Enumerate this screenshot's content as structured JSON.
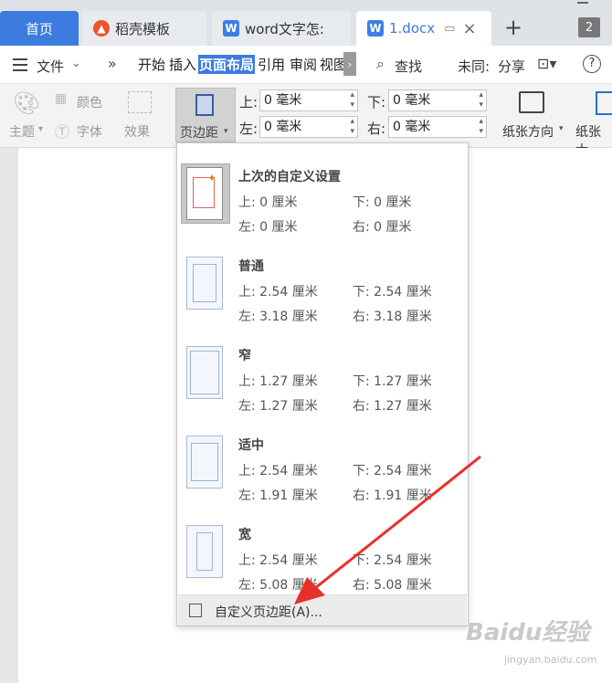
{
  "tabs": {
    "home": "首页",
    "daoke": "稻壳模板",
    "word_doc": "word文字怎:",
    "active_doc": "1.docx",
    "tab_count": "2"
  },
  "menu": {
    "file": "文件",
    "more": "»",
    "tabs": [
      "开始",
      "插入",
      "页面布局",
      "引用",
      "审阅",
      "视图"
    ],
    "search": "查找",
    "sync": "未同:",
    "share": "分享",
    "help": "?"
  },
  "ribbon": {
    "theme": "主题",
    "color": "颜色",
    "font": "字体",
    "effect": "效果",
    "margin_button": "页边距",
    "top_label": "上:",
    "bottom_label": "下:",
    "left_label": "左:",
    "right_label": "右:",
    "top_value": "0 毫米",
    "bottom_value": "0 毫米",
    "left_value": "0 毫米",
    "right_value": "0 毫米",
    "orientation": "纸张方向",
    "size": "纸张大"
  },
  "dropdown": {
    "presets": [
      {
        "title": "上次的自定义设置",
        "top": "上: 0 厘米",
        "bottom": "下: 0 厘米",
        "left": "左: 0 厘米",
        "right": "右: 0 厘米"
      },
      {
        "title": "普通",
        "top": "上: 2.54 厘米",
        "bottom": "下: 2.54 厘米",
        "left": "左: 3.18 厘米",
        "right": "右: 3.18 厘米"
      },
      {
        "title": "窄",
        "top": "上: 1.27 厘米",
        "bottom": "下: 1.27 厘米",
        "left": "左: 1.27 厘米",
        "right": "右: 1.27 厘米"
      },
      {
        "title": "适中",
        "top": "上: 2.54 厘米",
        "bottom": "下: 2.54 厘米",
        "left": "左: 1.91 厘米",
        "right": "右: 1.91 厘米"
      },
      {
        "title": "宽",
        "top": "上: 2.54 厘米",
        "bottom": "下: 2.54 厘米",
        "left": "左: 5.08 厘米",
        "right": "右: 5.08 厘米"
      }
    ],
    "custom": "自定义页边距(A)..."
  },
  "watermark": {
    "brand": "Baidu经验",
    "url": "jingyan.baidu.com"
  },
  "colors": {
    "accent": "#3c7be0",
    "arrow": "#e8302a"
  }
}
